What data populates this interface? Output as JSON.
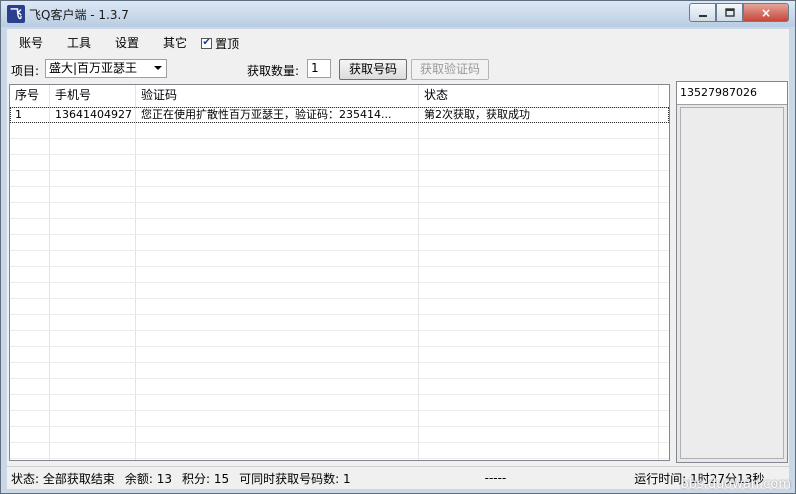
{
  "window": {
    "icon_text": "飞",
    "title": "飞Q客户端 - 1.3.7",
    "close_label": "×"
  },
  "menu": {
    "items": [
      "账号",
      "工具",
      "设置",
      "其它"
    ],
    "pin_label": "置顶",
    "pin_checked": true
  },
  "toolbar": {
    "project_label": "项目:",
    "project_value": "盛大|百万亚瑟王",
    "qty_label": "获取数量:",
    "qty_value": "1",
    "get_number_label": "获取号码",
    "get_code_label": "获取验证码"
  },
  "table": {
    "headers": [
      "序号",
      "手机号",
      "验证码",
      "状态"
    ],
    "rows": [
      [
        "1",
        "13641404927",
        "您正在使用扩散性百万亚瑟王，验证码：235414...",
        "第2次获取，获取成功"
      ]
    ]
  },
  "side": {
    "number": "13527987026"
  },
  "status": {
    "state": "状态:  全部获取结束",
    "balance": "余额:  13",
    "points": "积分:  15",
    "concurrent": "可同时获取号码数:  1",
    "dashes": "-----",
    "runtime": "运行时间:  1时27分13秒"
  },
  "watermark": "bbs.duowan.com"
}
